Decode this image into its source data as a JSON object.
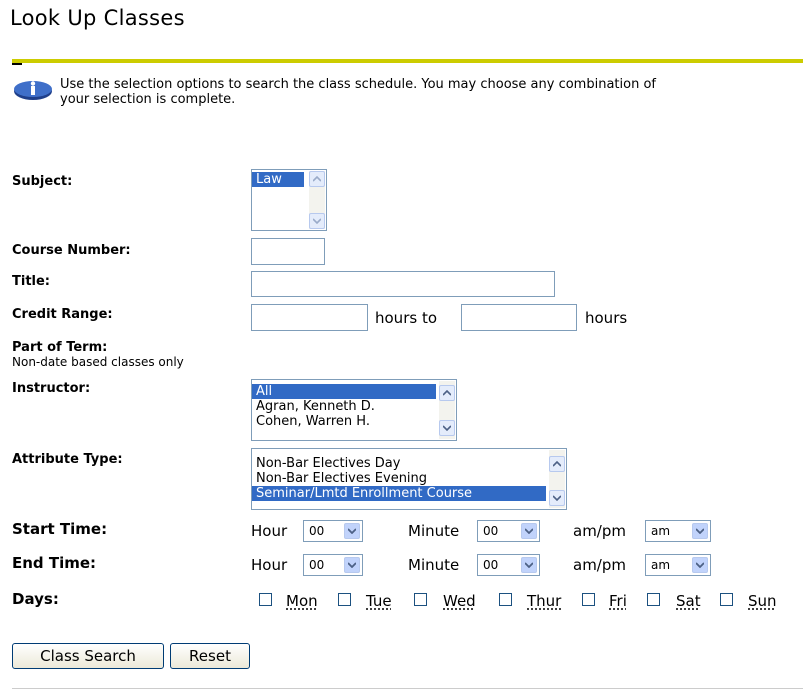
{
  "page": {
    "title": "Look Up Classes"
  },
  "info": {
    "text": "Use the selection options to search the class schedule. You may choose any combination of",
    "text2": "your selection is complete."
  },
  "form": {
    "subject": {
      "label": "Subject:",
      "options": [
        "Law"
      ],
      "selected": "Law"
    },
    "course_number": {
      "label": "Course Number:",
      "value": ""
    },
    "title": {
      "label": "Title:",
      "value": ""
    },
    "credit_range": {
      "label": "Credit Range:",
      "from": "",
      "to": "",
      "mid_text": "hours to",
      "end_text": "hours"
    },
    "part_of_term": {
      "label": "Part of Term:",
      "note": "Non-date based classes only"
    },
    "instructor": {
      "label": "Instructor:",
      "options": [
        "All",
        "Agran, Kenneth D.",
        "Cohen, Warren H."
      ],
      "selected": "All"
    },
    "attribute_type": {
      "label": "Attribute Type:",
      "options": [
        "Non-Bar Electives Day",
        "Non-Bar Electives Evening",
        "Seminar/Lmtd Enrollment Course"
      ],
      "selected": "Seminar/Lmtd Enrollment Course"
    },
    "start_time": {
      "label": "Start Time:",
      "hour_label": "Hour",
      "hour": "00",
      "minute_label": "Minute",
      "minute": "00",
      "ampm_label": "am/pm",
      "ampm": "am"
    },
    "end_time": {
      "label": "End Time:",
      "hour_label": "Hour",
      "hour": "00",
      "minute_label": "Minute",
      "minute": "00",
      "ampm_label": "am/pm",
      "ampm": "am"
    },
    "days": {
      "label": "Days:",
      "items": [
        "Mon",
        "Tue",
        "Wed",
        "Thur",
        "Fri",
        "Sat",
        "Sun"
      ]
    }
  },
  "buttons": {
    "search": "Class Search",
    "reset": "Reset"
  }
}
